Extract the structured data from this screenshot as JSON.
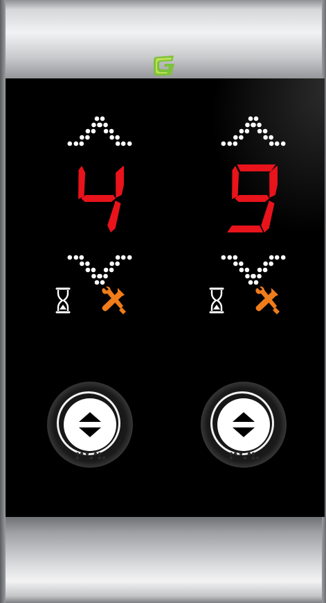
{
  "brand": {
    "logo_icon": "brand-s-logo-icon",
    "colors": {
      "green": "#7cc23a",
      "light_green": "#c8e25c"
    }
  },
  "colors": {
    "segment_on": "#e8131b",
    "dot": "#ffffff",
    "wrench": "#f07c1a"
  },
  "displays": [
    {
      "floor": "4",
      "icons": [
        "up-arrow-icon",
        "down-arrow-icon",
        "hourglass-icon",
        "tools-icon"
      ]
    },
    {
      "floor": "9",
      "icons": [
        "up-arrow-icon",
        "down-arrow-icon",
        "hourglass-icon",
        "tools-icon"
      ]
    }
  ],
  "call_buttons": [
    {
      "icon": "up-down-arrows-icon"
    },
    {
      "icon": "up-down-arrows-icon"
    }
  ]
}
